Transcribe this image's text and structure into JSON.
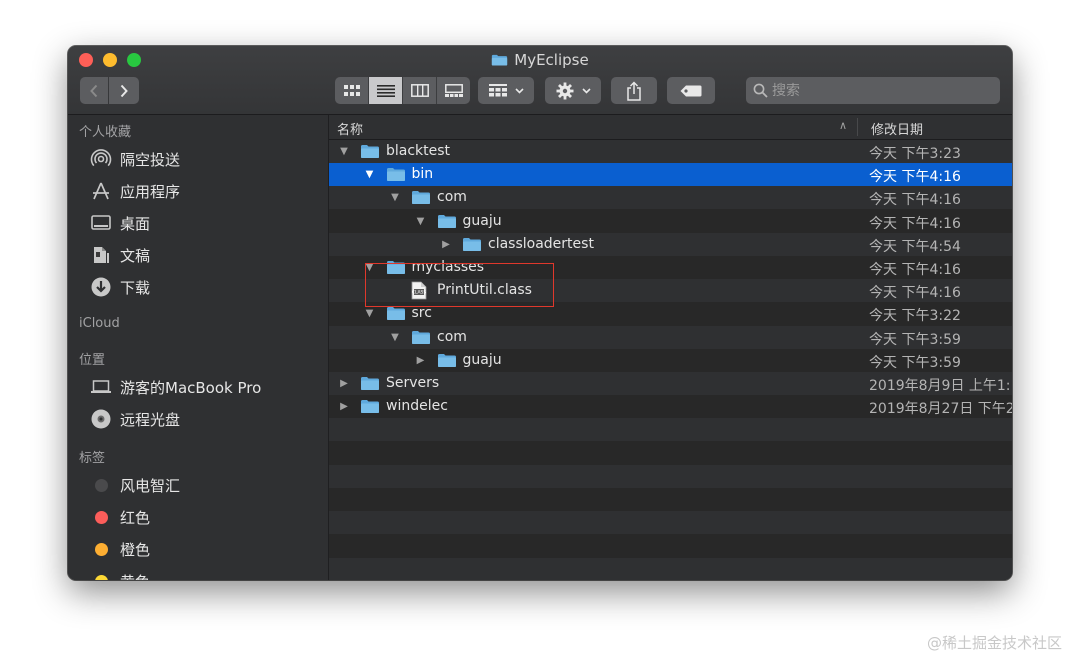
{
  "window": {
    "title": "MyEclipse"
  },
  "toolbar": {
    "search_placeholder": "搜索",
    "view_modes": [
      "icon-view",
      "list-view",
      "column-view",
      "gallery-view"
    ],
    "active_view": "list-view"
  },
  "sidebar": {
    "favorites_header": "个人收藏",
    "favorites": [
      {
        "label": "隔空投送",
        "icon": "airdrop-icon"
      },
      {
        "label": "应用程序",
        "icon": "applications-icon"
      },
      {
        "label": "桌面",
        "icon": "desktop-icon"
      },
      {
        "label": "文稿",
        "icon": "documents-icon"
      },
      {
        "label": "下载",
        "icon": "downloads-icon"
      }
    ],
    "icloud_header": "iCloud",
    "locations_header": "位置",
    "locations": [
      {
        "label": "游客的MacBook Pro",
        "icon": "laptop-icon"
      },
      {
        "label": "远程光盘",
        "icon": "disc-icon"
      }
    ],
    "tags_header": "标签",
    "tags": [
      {
        "label": "风电智汇",
        "color": "#4a4a4c"
      },
      {
        "label": "红色",
        "color": "#fc5d5a"
      },
      {
        "label": "橙色",
        "color": "#fdae32"
      },
      {
        "label": "黄色",
        "color": "#fdd835"
      }
    ]
  },
  "columns": {
    "name": "名称",
    "date": "修改日期"
  },
  "files": [
    {
      "name": "blacktest",
      "date": "今天 下午3:23",
      "level": 0,
      "type": "folder",
      "expanded": true
    },
    {
      "name": "bin",
      "date": "今天 下午4:16",
      "level": 1,
      "type": "folder",
      "expanded": true,
      "selected": true
    },
    {
      "name": "com",
      "date": "今天 下午4:16",
      "level": 2,
      "type": "folder",
      "expanded": true
    },
    {
      "name": "guaju",
      "date": "今天 下午4:16",
      "level": 3,
      "type": "folder",
      "expanded": true
    },
    {
      "name": "classloadertest",
      "date": "今天 下午4:54",
      "level": 4,
      "type": "folder",
      "expanded": false
    },
    {
      "name": "myclasses",
      "date": "今天 下午4:16",
      "level": 1,
      "type": "folder",
      "expanded": true
    },
    {
      "name": "PrintUtil.class",
      "date": "今天 下午4:16",
      "level": 2,
      "type": "file"
    },
    {
      "name": "src",
      "date": "今天 下午3:22",
      "level": 1,
      "type": "folder",
      "expanded": true
    },
    {
      "name": "com",
      "date": "今天 下午3:59",
      "level": 2,
      "type": "folder",
      "expanded": true
    },
    {
      "name": "guaju",
      "date": "今天 下午3:59",
      "level": 3,
      "type": "folder",
      "expanded": false
    },
    {
      "name": "Servers",
      "date": "2019年8月9日 上午1:",
      "level": 0,
      "type": "folder",
      "expanded": false
    },
    {
      "name": "windelec",
      "date": "2019年8月27日 下午2",
      "level": 0,
      "type": "folder",
      "expanded": false
    }
  ],
  "watermark": "@稀土掘金技术社区",
  "colors": {
    "selection": "#0a5fd0",
    "folder": "#5fa9dc",
    "highlight_box": "#e0382c"
  }
}
